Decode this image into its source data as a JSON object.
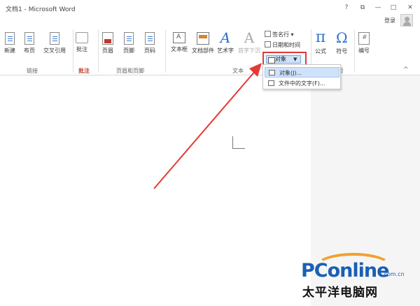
{
  "window": {
    "title": "文档1 - Microsoft Word",
    "controls": {
      "help": "?",
      "restore": "⧉",
      "minimize": "—",
      "maximize": "□",
      "close": "✕"
    },
    "login": "登录"
  },
  "ribbon": {
    "buttons": {
      "new_page": "新建",
      "layout": "布页",
      "cross_reference": "交叉引用",
      "comment": "批注",
      "header": "页眉",
      "footer": "页脚",
      "page_number": "页码",
      "text_box": "文本框",
      "quick_parts": "文档部件",
      "wordart": "艺术字",
      "drop_cap": "首字下沉",
      "equation": "公式",
      "symbol": "符号",
      "number": "编号"
    },
    "small_items": {
      "signature_line": "签名行",
      "date_time": "日期和时间",
      "object": "对象"
    },
    "groups": {
      "links": "链接",
      "comments_icon": "批注",
      "header_footer": "页眉和页脚",
      "text": "文本",
      "symbols": "符号"
    },
    "collapse": "^"
  },
  "object_menu": {
    "items": [
      "对象(J)...",
      "文件中的文字(F)..."
    ]
  },
  "watermark": {
    "brand": "PConline",
    "domain": ".com.cn",
    "cn": "太平洋电脑网"
  }
}
